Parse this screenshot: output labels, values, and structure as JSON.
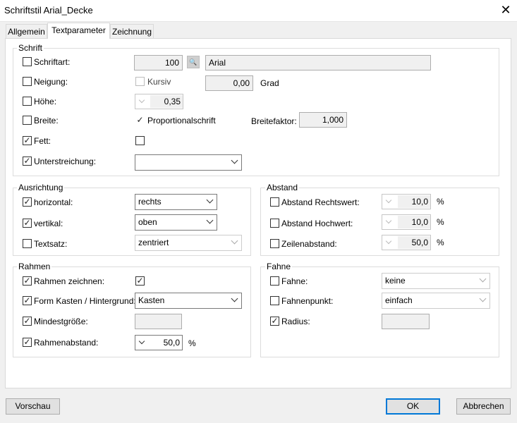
{
  "window": {
    "title": "Schriftstil Arial_Decke",
    "close_icon": "close-icon"
  },
  "tabs": [
    {
      "label": "Allgemein"
    },
    {
      "label": "Textparameter"
    },
    {
      "label": "Zeichnung"
    }
  ],
  "schrift": {
    "group_label": "Schrift",
    "schriftart": {
      "label": "Schriftart:",
      "checked": false,
      "number": "100",
      "font_name": "Arial"
    },
    "neigung": {
      "label": "Neigung:",
      "checked": false,
      "kursiv_label": "Kursiv",
      "kursiv_checked": false,
      "value": "0,00",
      "unit": "Grad"
    },
    "hoehe": {
      "label": "Höhe:",
      "checked": false,
      "value": "0,35"
    },
    "breite": {
      "label": "Breite:",
      "checked": false,
      "proportional_label": "Proportionalschrift",
      "proportional_checked": true,
      "breitefaktor_label": "Breitefaktor:",
      "breitefaktor_value": "1,000"
    },
    "fett": {
      "label": "Fett:",
      "checked": true,
      "value_checked": false
    },
    "unterstreichung": {
      "label": "Unterstreichung:",
      "checked": true,
      "value": ""
    }
  },
  "ausrichtung": {
    "group_label": "Ausrichtung",
    "horizontal": {
      "label": "horizontal:",
      "checked": true,
      "value": "rechts"
    },
    "vertikal": {
      "label": "vertikal:",
      "checked": true,
      "value": "oben"
    },
    "textsatz": {
      "label": "Textsatz:",
      "checked": false,
      "value": "zentriert"
    }
  },
  "abstand": {
    "group_label": "Abstand",
    "rechtswert": {
      "label": "Abstand Rechtswert:",
      "checked": false,
      "value": "10,0",
      "unit": "%"
    },
    "hochwert": {
      "label": "Abstand Hochwert:",
      "checked": false,
      "value": "10,0",
      "unit": "%"
    },
    "zeilenabstand": {
      "label": "Zeilenabstand:",
      "checked": false,
      "value": "50,0",
      "unit": "%"
    }
  },
  "rahmen": {
    "group_label": "Rahmen",
    "zeichnen": {
      "label": "Rahmen zeichnen:",
      "checked": true,
      "value_checked": true
    },
    "form": {
      "label": "Form Kasten / Hintergrund:",
      "checked": true,
      "value": "Kasten"
    },
    "mindestgroesse": {
      "label": "Mindestgröße:",
      "checked": true,
      "value": ""
    },
    "abstand": {
      "label": "Rahmenabstand:",
      "checked": true,
      "value": "50,0",
      "unit": "%"
    }
  },
  "fahne": {
    "group_label": "Fahne",
    "fahne": {
      "label": "Fahne:",
      "checked": false,
      "value": "keine"
    },
    "fahnenpunkt": {
      "label": "Fahnenpunkt:",
      "checked": false,
      "value": "einfach"
    },
    "radius": {
      "label": "Radius:",
      "checked": true,
      "value": ""
    }
  },
  "buttons": {
    "vorschau": "Vorschau",
    "ok": "OK",
    "abbrechen": "Abbrechen"
  },
  "glyphs": {
    "check": "✓",
    "close": "✕",
    "search": "🔍"
  },
  "colors": {
    "accent": "#0078d7"
  }
}
